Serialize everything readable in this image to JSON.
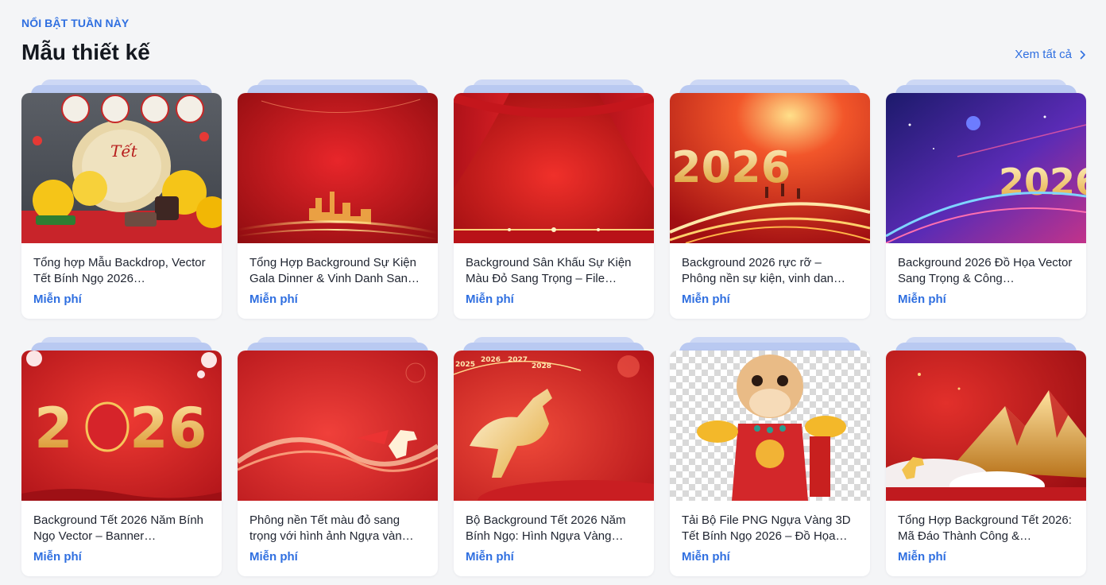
{
  "section": {
    "eyebrow": "NỔI BẬT TUẦN NÀY",
    "title": "Mẫu thiết kế",
    "see_all": "Xem tất cả"
  },
  "colors": {
    "accent": "#2f6fe0",
    "heading": "#14181f",
    "background": "#f4f5f7",
    "card": "#ffffff"
  },
  "cards": [
    {
      "title": "Tổng hợp Mẫu Backdrop, Vector Tết Bính Ngọ 2026…",
      "price": "Miễn phí",
      "thumb": "tet-backdrop-flowers"
    },
    {
      "title": "Tổng Hợp Background Sự Kiện Gala Dinner & Vinh Danh San…",
      "price": "Miễn phí",
      "thumb": "red-gala-city"
    },
    {
      "title": "Background Sân Khấu Sự Kiện Màu Đỏ Sang Trọng – File…",
      "price": "Miễn phí",
      "thumb": "red-stage-curtain"
    },
    {
      "title": "Background 2026 rực rỡ – Phông nền sự kiện, vinh dan…",
      "price": "Miễn phí",
      "thumb": "gold-2026-runners"
    },
    {
      "title": "Background 2026 Đồ Họa Vector Sang Trọng & Công…",
      "price": "Miễn phí",
      "thumb": "purple-2026-neon"
    },
    {
      "title": "Background Tết 2026 Năm Bính Ngọ Vector – Banner…",
      "price": "Miễn phí",
      "thumb": "red-2026-lantern"
    },
    {
      "title": "Phông nền Tết màu đỏ sang trọng với hình ảnh Ngựa vàn…",
      "price": "Miễn phí",
      "thumb": "red-horse-silk"
    },
    {
      "title": "Bộ Background Tết 2026 Năm Bính Ngọ: Hình Ngựa Vàng…",
      "price": "Miễn phí",
      "thumb": "gold-horse-years"
    },
    {
      "title": "Tải Bộ File PNG Ngựa Vàng 3D Tết Bính Ngọ 2026 – Đồ Họa…",
      "price": "Miễn phí",
      "thumb": "horse-mascot-png"
    },
    {
      "title": "Tổng Hợp Background Tết 2026: Mã Đáo Thành Công &…",
      "price": "Miễn phí",
      "thumb": "gold-mountain-horse"
    }
  ]
}
